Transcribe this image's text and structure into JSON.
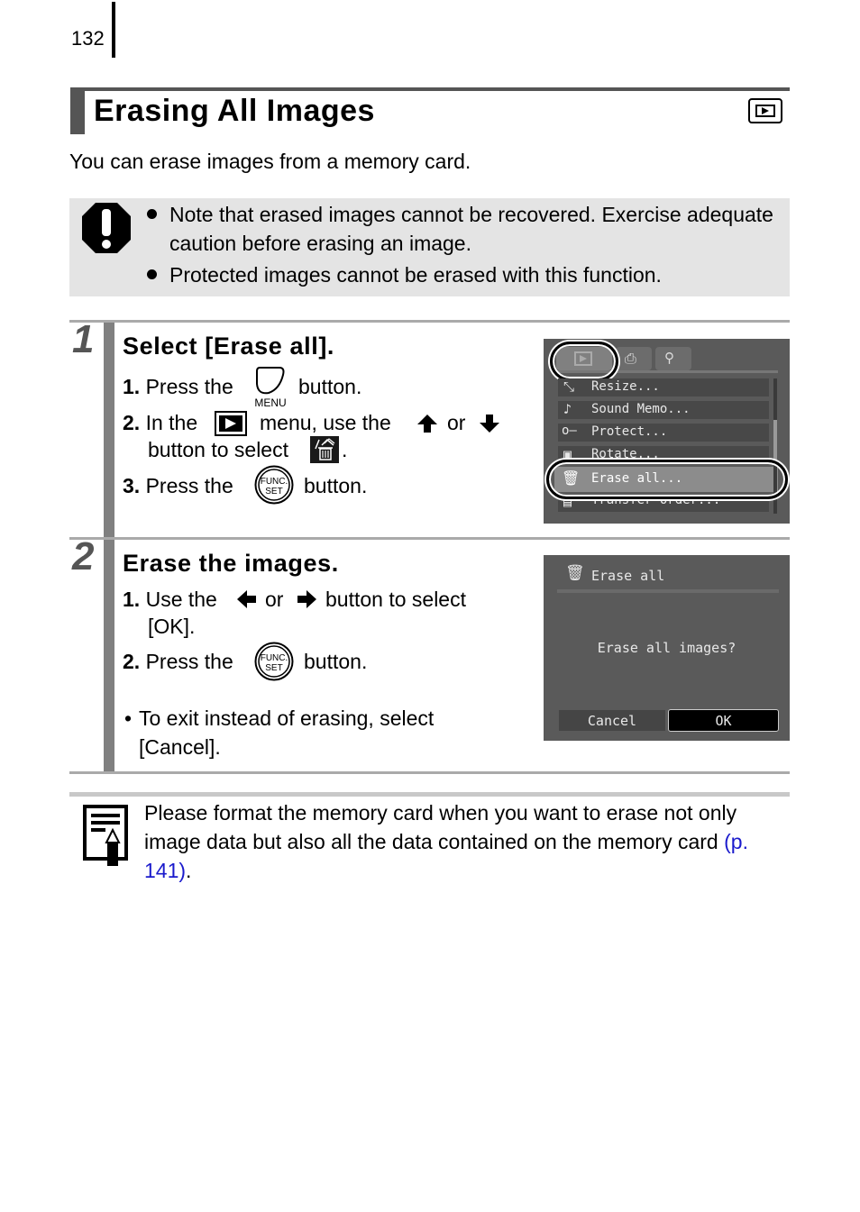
{
  "page": {
    "number": "132"
  },
  "header": {
    "title": "Erasing All Images",
    "mode_icon": "playback-mode-icon"
  },
  "intro": "You can erase images from a memory card.",
  "caution": {
    "icon": "caution-icon",
    "items": [
      "Note that erased images cannot be recovered. Exercise adequate caution before erasing an image.",
      "Protected images cannot be erased with this function."
    ]
  },
  "steps": [
    {
      "number": "1",
      "heading": "Select [Erase all].",
      "lines": [
        {
          "num": "1.",
          "before": "Press the",
          "icon": "menu-button-icon",
          "icon_label": "MENU",
          "after": "button."
        },
        {
          "num": "2.",
          "before": "In the",
          "icon": "playback-menu-icon",
          "middle": "menu, use the",
          "icon2": "up-arrow-icon",
          "or": "or",
          "icon3": "down-arrow-icon",
          "cont": "button to select",
          "icon4": "erase-all-icon",
          "end": "."
        },
        {
          "num": "3.",
          "before": "Press the",
          "icon": "func-set-button-icon",
          "icon_label_top": "FUNC.",
          "icon_label_bottom": "SET",
          "after": "button."
        }
      ],
      "screen": {
        "tabs": [
          "playback",
          "print",
          "setup"
        ],
        "menu_items": [
          "Resize...",
          "Sound Memo...",
          "Protect...",
          "Rotate...",
          "Erase all...",
          "Transfer Order..."
        ],
        "selected": "Erase all..."
      }
    },
    {
      "number": "2",
      "heading": "Erase the images.",
      "lines": [
        {
          "num": "1.",
          "before": "Use the",
          "icon": "left-arrow-icon",
          "or": "or",
          "icon2": "right-arrow-icon",
          "after": "button to select",
          "cont": "[OK]."
        },
        {
          "num": "2.",
          "before": "Press the",
          "icon": "func-set-button-icon",
          "icon_label_top": "FUNC.",
          "icon_label_bottom": "SET",
          "after": "button."
        }
      ],
      "note": "To exit instead of erasing, select [Cancel].",
      "note_line1": "To exit instead of erasing, select",
      "note_line2": "[Cancel].",
      "screen": {
        "title": "Erase all",
        "message": "Erase all images?",
        "cancel_label": "Cancel",
        "ok_label": "OK",
        "selected": "OK"
      }
    }
  ],
  "memo": {
    "icon": "memo-icon",
    "text_before": "Please format the memory card when you want to erase not only image data but also all the data contained on the memory card",
    "link": "(p. 141)",
    "text_after": "."
  },
  "colors": {
    "link": "#1a1acc",
    "caution_bg": "#e4e4e4",
    "step_bar": "#808080",
    "screen_bg": "#5a5a5a"
  }
}
